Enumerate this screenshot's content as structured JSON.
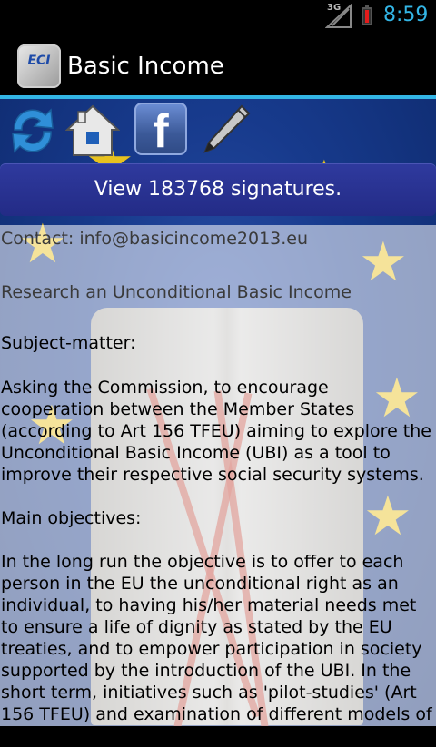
{
  "status_bar": {
    "network": "3G",
    "time": "8:59"
  },
  "action_bar": {
    "app_icon_text": "ECI",
    "title": "Basic Income"
  },
  "toolbar": {
    "icons": [
      "refresh-icon",
      "home-icon",
      "facebook-icon",
      "pen-icon"
    ],
    "facebook_glyph": "f"
  },
  "signatures_button": "View 183768 signatures.",
  "contact": "Contact: info@basicincome2013.eu",
  "research": "Research an Unconditional Basic Income",
  "subject_heading": "Subject-matter:",
  "subject_text": "Asking the Commission, to encourage cooperation between the Member States (according to Art 156 TFEU) aiming to explore the Unconditional Basic Income (UBI) as a tool to improve their respective social security systems.",
  "objectives_heading": "Main objectives:",
  "objectives_text": "In the long run the objective is to offer to each person in the EU the unconditional right as an individual, to having his/her material needs met to ensure a life of dignity as stated by the EU treaties, and to empower participation in society supported by the introduction of the UBI. In the short term, initiatives such as 'pilot-studies' (Art 156 TFEU) and examination of different models of UBI (EP",
  "colors": {
    "accent": "#33b5e5",
    "button": "#232b86",
    "battery_alert": "#e41b1b"
  }
}
